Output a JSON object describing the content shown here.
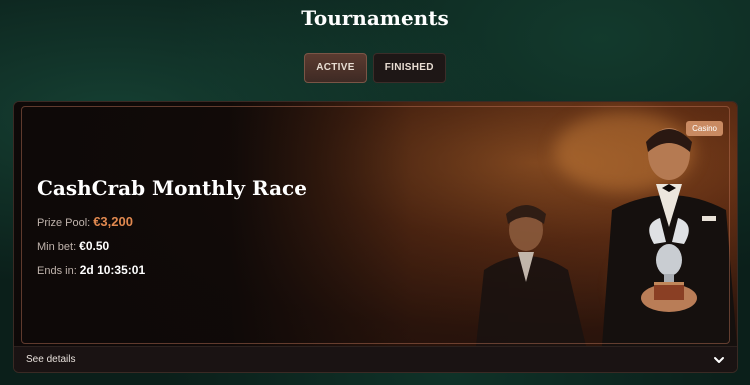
{
  "header": {
    "title": "Tournaments"
  },
  "tabs": [
    {
      "label": "ACTIVE",
      "active": true
    },
    {
      "label": "FINISHED",
      "active": false
    }
  ],
  "tournament": {
    "badge": "Casino",
    "name": "CashCrab Monthly Race",
    "prize_label": "Prize Pool:",
    "prize_value": "€3,200",
    "minbet_label": "Min bet:",
    "minbet_value": "€0.50",
    "ends_label": "Ends in:",
    "ends_value": "2d 10:35:01",
    "details_label": "See details"
  },
  "icons": {
    "expand": "chevron-down-icon"
  },
  "colors": {
    "accent": "#e0884f",
    "badge": "#c98a62",
    "active_tab": "#4a3029"
  }
}
